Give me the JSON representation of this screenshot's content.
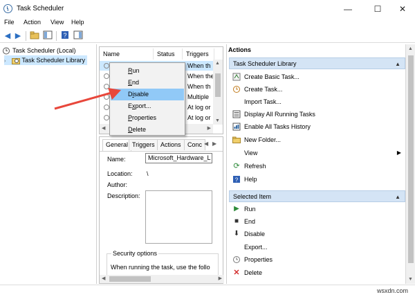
{
  "window": {
    "title": "Task Scheduler",
    "minimize": "—",
    "maximize": "☐",
    "close": "✕"
  },
  "menu": [
    "File",
    "Action",
    "View",
    "Help"
  ],
  "tree": {
    "root": "Task Scheduler (Local)",
    "library": "Task Scheduler Library"
  },
  "task_list": {
    "columns": [
      "Name",
      "Status",
      "Triggers"
    ],
    "triggers": [
      "When th",
      "When the",
      "When th",
      "Multiple",
      "At log or",
      "At log or"
    ]
  },
  "context_menu": {
    "items": [
      {
        "label": "Run",
        "accel": "R"
      },
      {
        "label": "End",
        "accel": "E"
      },
      {
        "label": "Disable",
        "accel": "i"
      },
      {
        "label": "Export...",
        "accel": "x"
      },
      {
        "label": "Properties",
        "accel": "P"
      },
      {
        "label": "Delete",
        "accel": "D"
      }
    ],
    "hover_index": 2
  },
  "details": {
    "tabs": [
      "General",
      "Triggers",
      "Actions",
      "Conc"
    ],
    "name_label": "Name:",
    "name_value": "Microsoft_Hardware_L",
    "location_label": "Location:",
    "location_value": "\\",
    "author_label": "Author:",
    "description_label": "Description:",
    "security_title": "Security options",
    "security_text": "When running the task, use the follo"
  },
  "actions": {
    "heading": "Actions",
    "library_section": "Task Scheduler Library",
    "library_items": [
      {
        "label": "Create Basic Task...",
        "icon": "create-basic-task-icon"
      },
      {
        "label": "Create Task...",
        "icon": "create-task-icon"
      },
      {
        "label": "Import Task...",
        "icon": "import-task-icon"
      },
      {
        "label": "Display All Running Tasks",
        "icon": "running-tasks-icon"
      },
      {
        "label": "Enable All Tasks History",
        "icon": "history-icon"
      },
      {
        "label": "New Folder...",
        "icon": "folder-icon"
      },
      {
        "label": "View",
        "icon": "view-icon"
      },
      {
        "label": "Refresh",
        "icon": "refresh-icon"
      },
      {
        "label": "Help",
        "icon": "help-icon"
      }
    ],
    "selected_section": "Selected Item",
    "selected_items": [
      {
        "label": "Run",
        "icon": "run-icon"
      },
      {
        "label": "End",
        "icon": "end-icon"
      },
      {
        "label": "Disable",
        "icon": "disable-icon"
      },
      {
        "label": "Export...",
        "icon": "export-icon"
      },
      {
        "label": "Properties",
        "icon": "properties-icon"
      },
      {
        "label": "Delete",
        "icon": "delete-icon"
      }
    ]
  },
  "watermark": "wsxdn.com",
  "colors": {
    "arrow": "#e8473b",
    "hover": "#91c9f7",
    "selected": "#cce8ff",
    "section_bar": "#d4e4f5"
  }
}
